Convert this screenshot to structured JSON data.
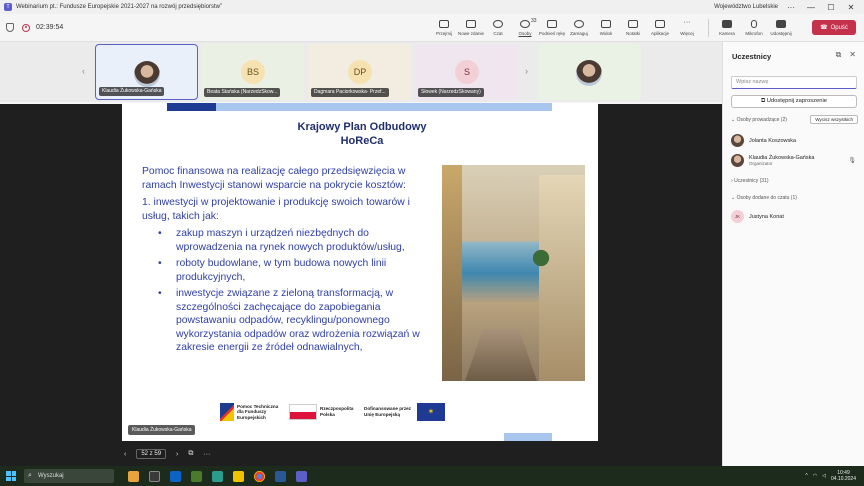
{
  "window": {
    "title": "Webinarium pt.: Fundusze Europejskie 2021-2027 na rozwój przedsiębiorstw”",
    "org": "Województwo Lubelskie",
    "controls": [
      "···",
      "—",
      "☐",
      "✕"
    ]
  },
  "toolbar": {
    "timer": "02:39:54",
    "tools": [
      {
        "label": "Przejmij",
        "icon": "pointer-icon"
      },
      {
        "label": "Nowe zdanie",
        "icon": "raise-icon"
      },
      {
        "label": "Czat",
        "icon": "chat-icon"
      },
      {
        "label": "Osoby",
        "icon": "people-icon",
        "count": "33"
      },
      {
        "label": "Podnieś rękę",
        "icon": "hand-icon"
      },
      {
        "label": "Zareaguj",
        "icon": "react-icon"
      },
      {
        "label": "Widok",
        "icon": "view-icon"
      },
      {
        "label": "Notatki",
        "icon": "notes-icon"
      },
      {
        "label": "Aplikacje",
        "icon": "apps-icon"
      },
      {
        "label": "Więcej",
        "icon": "more-icon"
      }
    ],
    "media": [
      {
        "label": "Kamera",
        "icon": "camera-icon"
      },
      {
        "label": "Mikrofon",
        "icon": "mic-icon"
      },
      {
        "label": "Udostępnij",
        "icon": "share-icon"
      }
    ],
    "leave_label": "Opuść"
  },
  "participants_strip": [
    {
      "name": "Klaudia Żukowska-Gańska",
      "type": "photo"
    },
    {
      "name": "Beata Stańska (NarzedzSkow...",
      "initials": "BS"
    },
    {
      "name": "Dagmara Paciorkowska- Przef...",
      "initials": "DP"
    },
    {
      "name": "Słowek (NarzedzSkowany)",
      "initials": "S"
    },
    {
      "name": "",
      "type": "photo"
    }
  ],
  "slide": {
    "title_line1": "Krajowy Plan Odbudowy",
    "title_line2": "HoReCa",
    "intro": "Pomoc finansowa na realizację całego przedsięwzięcia w ramach Inwestycji stanowi wsparcie na pokrycie kosztów:",
    "point1": "1. inwestycji w projektowanie i produkcję swoich towarów i usług, takich jak:",
    "bullets": [
      "zakup maszyn i urządzeń niezbędnych do wprowadzenia na rynek nowych produktów/usług,",
      "roboty budowlane, w tym budowa nowych linii produkcyjnych,",
      "inwestycje związane z zieloną transformacją, w szczególności zachęcające do zapobiegania powstawaniu odpadów, recyklingu/ponownego wykorzystania odpadów oraz wdrożenia rozwiązań w zakresie energii ze źródeł odnawialnych,"
    ],
    "logo1": "Pomoc Techniczna dla Funduszy Europejskich",
    "logo2": "Rzeczpospolita Polska",
    "logo3": "Dofinansowane przez Unię Europejską",
    "presenter_tag": "Klaudia Żukowska-Gańska"
  },
  "pager": {
    "current": "52 z 59"
  },
  "panel": {
    "title": "Uczestnicy",
    "search_placeholder": "Wpisz nazwę",
    "share_label": "Udostępnij zaproszenie",
    "section_presenters": "Osoby prowadzące (2)",
    "mute_all": "Wycisz wszystkich",
    "presenters": [
      {
        "name": "Jolanta Koszowska",
        "role": ""
      },
      {
        "name": "Klaudia Żukowska-Gańska",
        "role": "Organizator"
      }
    ],
    "section_attendees": "Uczestnicy (31)",
    "section_lobby": "Osoby dodane do czatu (1)",
    "lobby": [
      {
        "name": "Justyna Konat",
        "initials": "JK"
      }
    ]
  },
  "taskbar": {
    "search": "Wyszukaj",
    "time": "10:49",
    "date": "04.10.2024"
  }
}
